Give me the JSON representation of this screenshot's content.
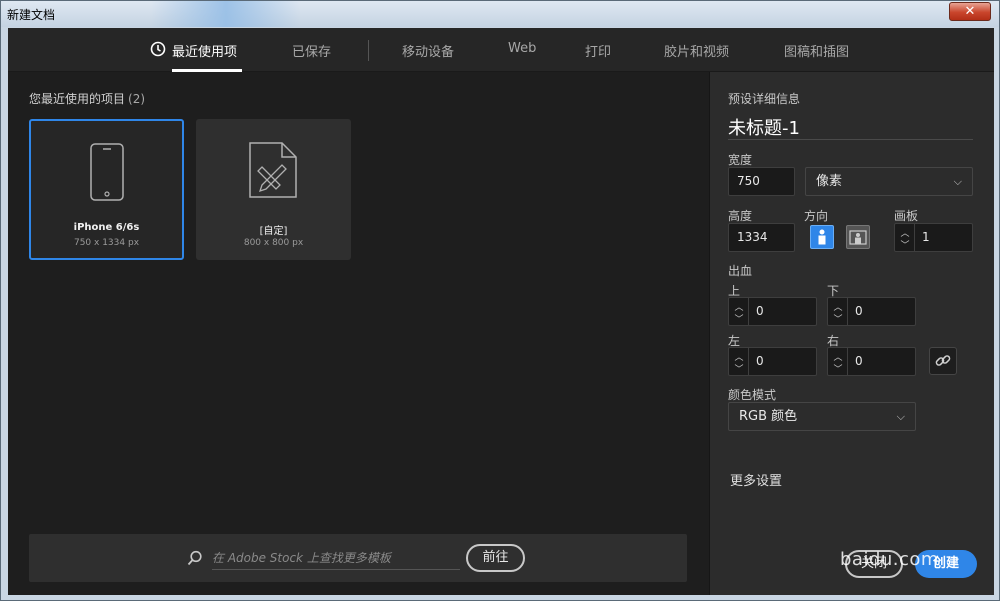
{
  "window": {
    "title": "新建文档",
    "close_glyph": "✕"
  },
  "tabs": [
    {
      "label": "最近使用项",
      "active": true
    },
    {
      "label": "已保存"
    },
    {
      "label": "移动设备"
    },
    {
      "label": "Web"
    },
    {
      "label": "打印"
    },
    {
      "label": "胶片和视频"
    },
    {
      "label": "图稿和插图"
    }
  ],
  "recent": {
    "title": "您最近使用的项目",
    "count": "(2)",
    "items": [
      {
        "name": "iPhone 6/6s",
        "size": "750 x 1334 px",
        "icon": "phone-icon",
        "selected": true
      },
      {
        "name": "[自定]",
        "size": "800 x 800 px",
        "icon": "custom-doc-icon",
        "selected": false
      }
    ]
  },
  "search": {
    "placeholder": "在 Adobe Stock 上查找更多模板",
    "go_label": "前往"
  },
  "preset": {
    "section_label": "预设详细信息",
    "doc_title": "未标题-1",
    "width_label": "宽度",
    "width_value": "750",
    "unit": "像素",
    "height_label": "高度",
    "height_value": "1334",
    "orientation_label": "方向",
    "artboard_label": "画板",
    "artboard_value": "1",
    "bleed_label": "出血",
    "bleed_top_label": "上",
    "bleed_top": "0",
    "bleed_bottom_label": "下",
    "bleed_bottom": "0",
    "bleed_left_label": "左",
    "bleed_left": "0",
    "bleed_right_label": "右",
    "bleed_right": "0",
    "color_mode_label": "颜色模式",
    "color_mode": "RGB 颜色",
    "more_settings": "更多设置",
    "close_label": "关闭",
    "create_label": "创建"
  },
  "watermark": "baidu.com",
  "colors": {
    "accent": "#2f86e8",
    "panel": "#2c2c2c",
    "main": "#1e1e1e"
  }
}
